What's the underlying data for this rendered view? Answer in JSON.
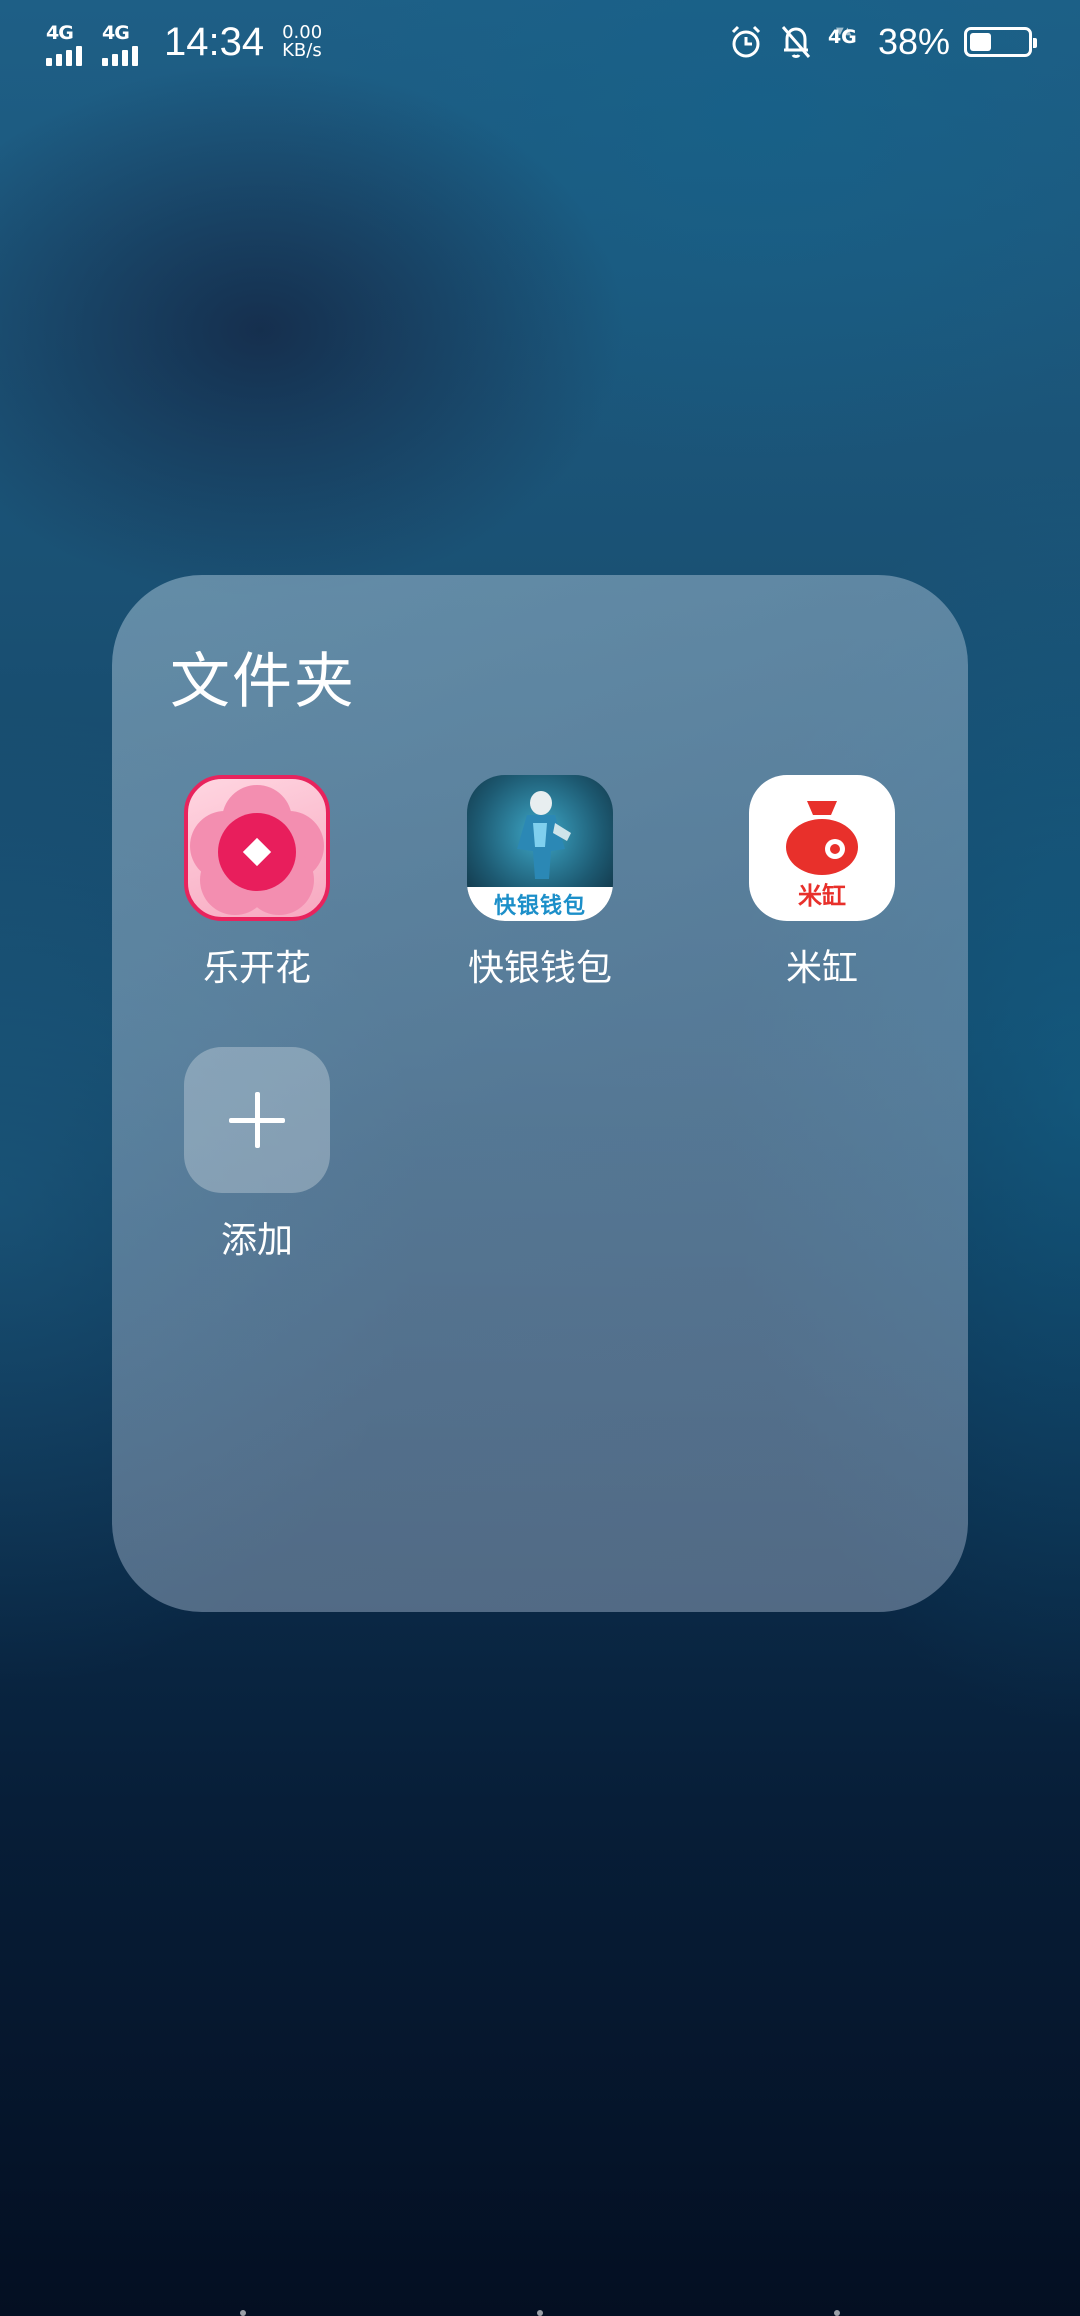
{
  "status_bar": {
    "sim1_network": "4G",
    "sim2_network": "4G",
    "time": "14:34",
    "speed_value": "0.00",
    "speed_unit": "KB/s",
    "data_network": "4G",
    "battery_percent": "38%",
    "battery_level": 0.38
  },
  "folder": {
    "title": "文件夹",
    "apps": [
      {
        "label": "乐开花",
        "icon": "lekaihua-app-icon"
      },
      {
        "label": "快银钱包",
        "icon": "kuaiyin-wallet-app-icon",
        "icon_text": "快银钱包"
      },
      {
        "label": "米缸",
        "icon": "migang-app-icon",
        "icon_text": "米缸"
      }
    ],
    "add_label": "添加"
  },
  "colors": {
    "lekaihua_accent": "#e81e5c",
    "kuaiyin_accent": "#1c8fc9",
    "migang_accent": "#e8302b"
  }
}
